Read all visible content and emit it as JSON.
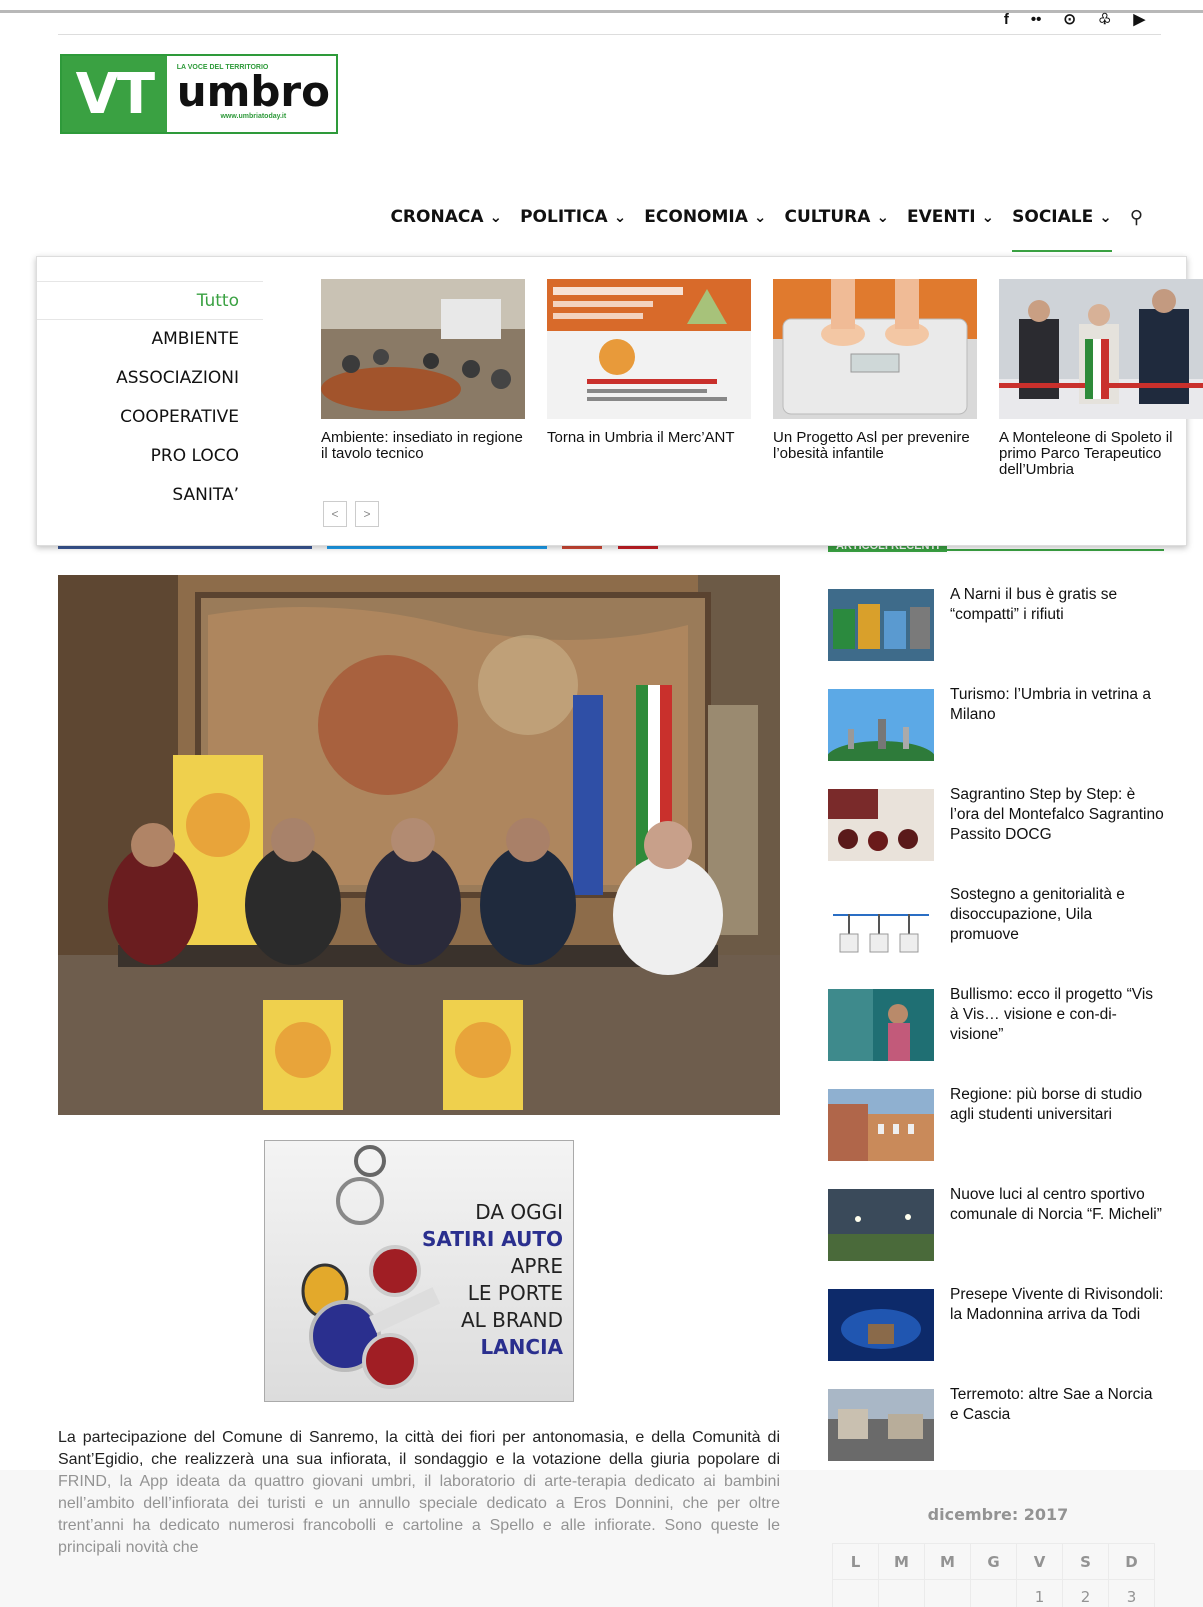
{
  "social": {
    "icons": [
      "facebook-icon",
      "flickr-icon",
      "rss-icon",
      "twitter-icon",
      "youtube-icon"
    ],
    "glyphs": [
      "f",
      "••",
      "⊙",
      "♧",
      "▶"
    ]
  },
  "logo": {
    "letters": "VT",
    "tagline": "LA VOCE DEL TERRITORIO",
    "name": "umbro",
    "url": "www.umbriatoday.it"
  },
  "nav": {
    "items": [
      "CRONACA",
      "POLITICA",
      "ECONOMIA",
      "CULTURA",
      "EVENTI",
      "SOCIALE"
    ],
    "active": "SOCIALE"
  },
  "mega": {
    "categories": [
      "Tutto",
      "AMBIENTE",
      "ASSOCIAZIONI",
      "COOPERATIVE",
      "PRO LOCO",
      "SANITA’"
    ],
    "posts": [
      {
        "title": "Ambiente: insediato in regione il tavolo tecnico"
      },
      {
        "title": "Torna in Umbria il Merc’ANT"
      },
      {
        "title": "Un Progetto Asl per prevenire l’obesità infantile"
      },
      {
        "title": "A Monteleone di Spoleto il primo Parco Terapeutico dell’Umbria"
      }
    ],
    "prev": "<",
    "next": ">"
  },
  "sidebar": {
    "heading": "ARTICOLI RECENTI",
    "items": [
      {
        "title": "A Narni il bus è gratis se “compatti” i rifiuti"
      },
      {
        "title": "Turismo: l’Umbria in vetrina a Milano"
      },
      {
        "title": "Sagrantino Step by Step: è l’ora del Montefalco Sagrantino Passito DOCG"
      },
      {
        "title": "Sostegno a genitorialità e disoccupazione, Uila promuove"
      },
      {
        "title": "Bullismo: ecco il progetto “Vis à Vis… visione e con-di-visione”"
      },
      {
        "title": "Regione: più borse di studio agli studenti universitari"
      },
      {
        "title": "Nuove luci al centro sportivo comunale di Norcia “F. Micheli”"
      },
      {
        "title": "Presepe Vivente di Rivisondoli: la Madonnina arriva da Todi"
      },
      {
        "title": "Terremoto: altre Sae a Norcia e Cascia"
      }
    ]
  },
  "ad": {
    "line1": "DA OGGI",
    "line2": "SATIRI AUTO",
    "line3": "APRE",
    "line4": "LE PORTE",
    "line5": "AL BRAND",
    "line6": "LANCIA"
  },
  "article": {
    "body": "La partecipazione del Comune di Sanremo, la città dei fiori per antonomasia, e della Comunità di Sant’Egidio, che realizzerà una sua infiorata, il sondaggio e la votazione della giuria popolare di FRIND, la App ideata da quattro giovani umbri, il laboratorio di arte-terapia dedicato ai bambini nell’ambito dell’infiorata dei turisti e un annullo speciale dedicato a Eros Donnini, che per oltre trent’anni ha dedicato numerosi francobolli e cartoline a Spello e alle infiorate. Sono queste le principali novità che"
  },
  "calendar": {
    "title": "dicembre: 2017",
    "headers": [
      "L",
      "M",
      "M",
      "G",
      "V",
      "S",
      "D"
    ],
    "first_row": [
      "",
      "",
      "",
      "",
      "1",
      "2",
      "3"
    ]
  }
}
